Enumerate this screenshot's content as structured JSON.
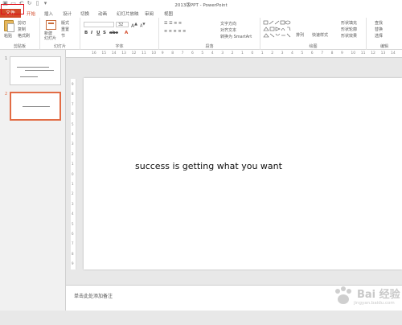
{
  "window": {
    "title": "2013版PPT - PowerPoint"
  },
  "ribbon_tabs": [
    "文件",
    "开始",
    "插入",
    "设计",
    "切换",
    "动画",
    "幻灯片放映",
    "审阅",
    "视图"
  ],
  "groups": {
    "clipboard": {
      "label": "剪贴板",
      "paste": "粘贴",
      "cut": "剪切",
      "copy": "复制",
      "format_painter": "格式刷"
    },
    "slides": {
      "label": "幻灯片",
      "new_slide": "新建\n幻灯片",
      "layout": "版式",
      "reset": "重置",
      "section": "节"
    },
    "font": {
      "label": "字体",
      "size": "32"
    },
    "paragraph": {
      "label": "段落",
      "text_direction": "文字方向",
      "align_text": "对齐文本",
      "smartart": "转换为 SmartArt"
    },
    "drawing": {
      "label": "绘图",
      "arrange": "排列",
      "quick_styles": "快速样式",
      "shape_fill": "形状填充",
      "shape_outline": "形状轮廓",
      "shape_effects": "形状效果"
    },
    "editing": {
      "label": "编辑",
      "find": "查找",
      "replace": "替换",
      "select": "选择"
    }
  },
  "thumbnails": [
    {
      "number": "1"
    },
    {
      "number": "2",
      "selected": true
    }
  ],
  "ruler_h": [
    "16",
    "15",
    "14",
    "13",
    "12",
    "11",
    "10",
    "9",
    "8",
    "7",
    "6",
    "5",
    "4",
    "3",
    "2",
    "1",
    "0",
    "1",
    "2",
    "3",
    "4",
    "5",
    "6",
    "7",
    "8",
    "9",
    "10",
    "11",
    "12",
    "13",
    "14"
  ],
  "ruler_v": [
    "9",
    "8",
    "7",
    "6",
    "5",
    "4",
    "3",
    "2",
    "1",
    "0",
    "1",
    "2",
    "3",
    "4",
    "5",
    "6",
    "7",
    "8",
    "9"
  ],
  "slide": {
    "text": "success is getting what you want"
  },
  "notes": {
    "placeholder": "单击此处添加备注"
  },
  "watermark": {
    "brand": "Bai 经验",
    "site": "jingyan.baidu.com"
  },
  "colors": {
    "accent": "#d24726",
    "highlight": "#e0101a",
    "thumb_selected": "#e26c45"
  }
}
